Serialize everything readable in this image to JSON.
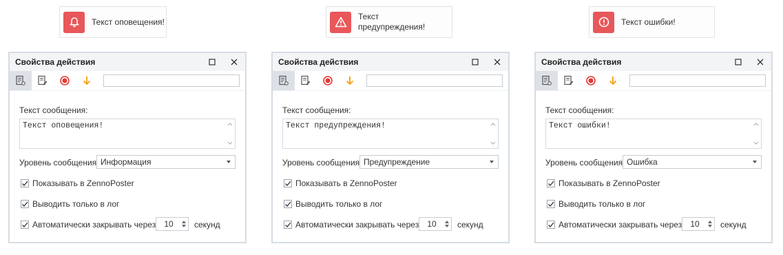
{
  "toasts": [
    {
      "text": "Текст оповещения!",
      "icon": "bell-icon"
    },
    {
      "text": "Текст\nпредупреждения!",
      "icon": "warning-icon"
    },
    {
      "text": "Текст ошибки!",
      "icon": "error-icon"
    }
  ],
  "colors": {
    "accent": "#e8575a",
    "record": "#e53935",
    "arrow": "#f5a623"
  },
  "panels": [
    {
      "title": "Свойства действия",
      "msg_label": "Текст сообщения:",
      "msg_value": "Текст оповещения!",
      "level_label": "Уровень сообщения:",
      "level_value": "Информация",
      "chk_show": "Показывать в ZennoPoster",
      "chk_log": "Выводить только в лог",
      "chk_auto": "Автоматически закрывать через",
      "seconds_value": "10",
      "seconds_label": "секунд"
    },
    {
      "title": "Свойства действия",
      "msg_label": "Текст сообщения:",
      "msg_value": "Текст предупреждения!",
      "level_label": "Уровень сообщения:",
      "level_value": "Предупреждение",
      "chk_show": "Показывать в ZennoPoster",
      "chk_log": "Выводить только в лог",
      "chk_auto": "Автоматически закрывать через",
      "seconds_value": "10",
      "seconds_label": "секунд"
    },
    {
      "title": "Свойства действия",
      "msg_label": "Текст сообщения:",
      "msg_value": "Текст ошибки!",
      "level_label": "Уровень сообщения:",
      "level_value": "Ошибка",
      "chk_show": "Показывать в ZennoPoster",
      "chk_log": "Выводить только в лог",
      "chk_auto": "Автоматически закрывать через",
      "seconds_value": "10",
      "seconds_label": "секунд"
    }
  ]
}
